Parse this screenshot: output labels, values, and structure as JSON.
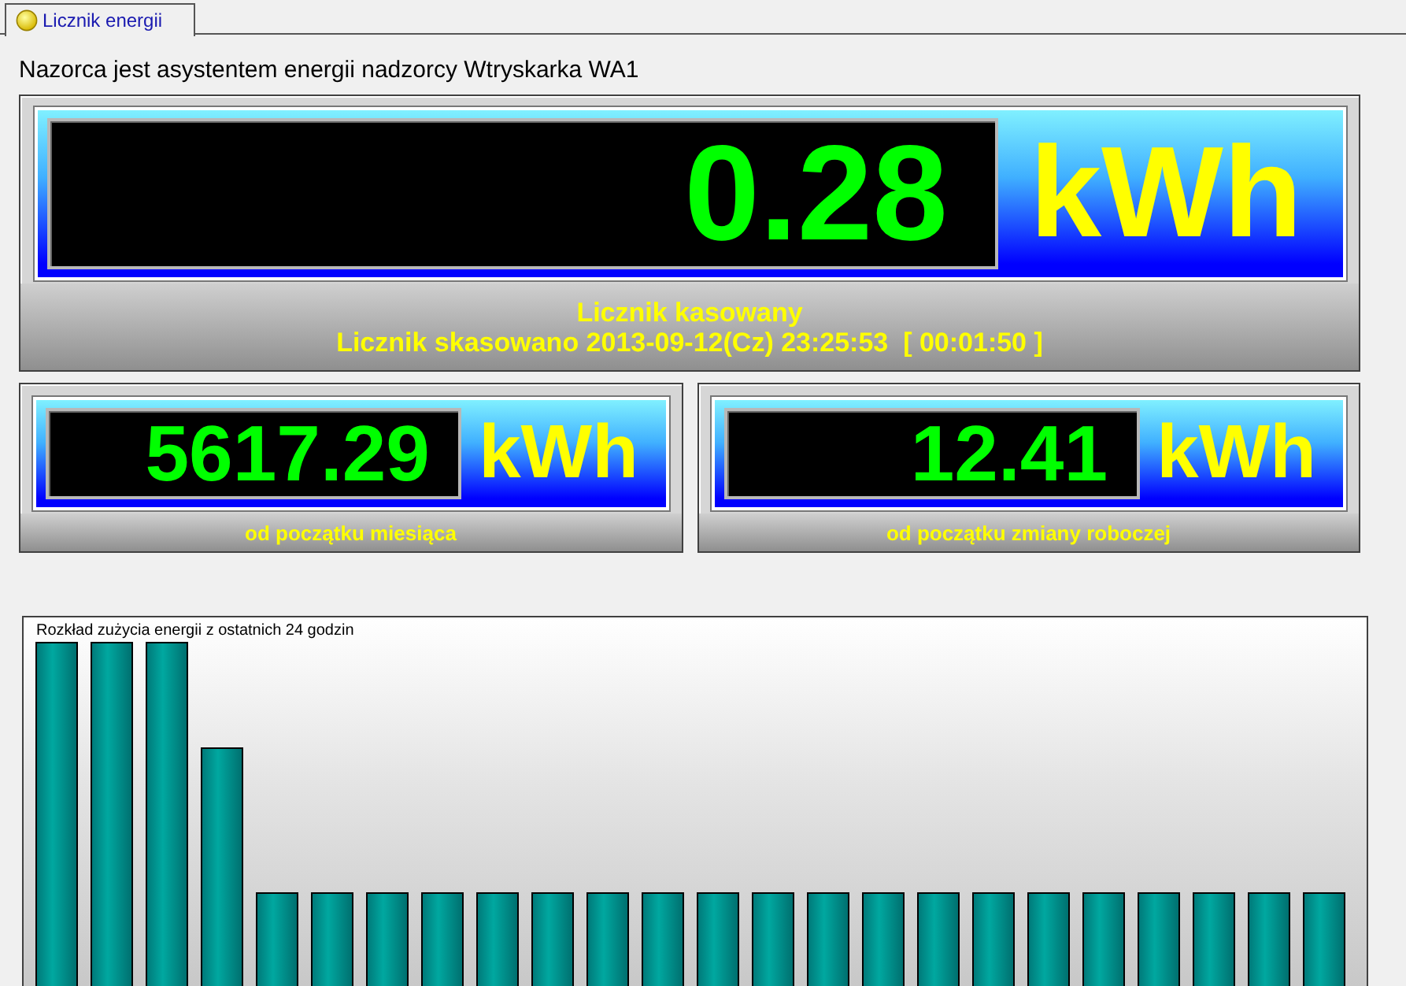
{
  "tab": {
    "label": "Licznik energii",
    "selected": true
  },
  "heading": "Nazorca jest asystentem energii nadzorcy Wtryskarka WA1",
  "main_meter": {
    "value": "0.28",
    "unit": "kWh",
    "caption": "Licznik kasowany",
    "detail": "Licznik skasowano 2013-09-12(Cz) 23:25:53  [ 00:01:50 ]"
  },
  "meters": [
    {
      "value": "5617.29",
      "unit": "kWh",
      "caption": "od początku miesiąca"
    },
    {
      "value": "12.41",
      "unit": "kWh",
      "caption": "od początku zmiany roboczej"
    }
  ],
  "chart": {
    "title": "Rozkład zużycia energii z ostatnich 24 godzin"
  }
}
